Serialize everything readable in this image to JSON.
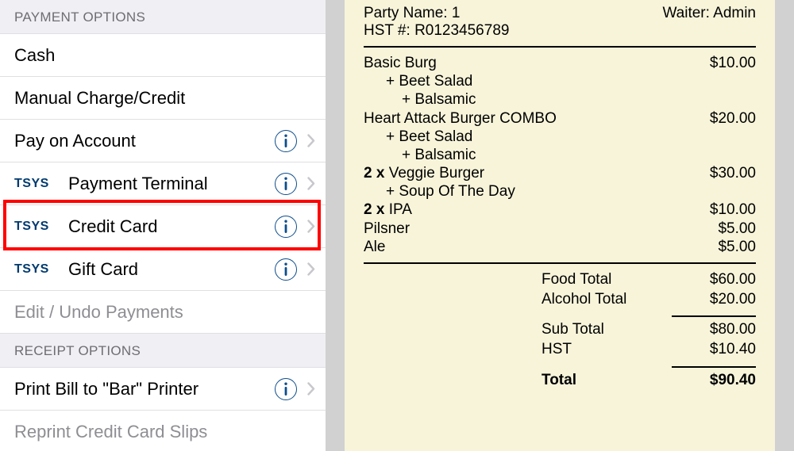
{
  "sidebar": {
    "sections": [
      {
        "title": "PAYMENT OPTIONS",
        "items": [
          {
            "label": "Cash",
            "brand": null,
            "info": false,
            "chevron": false,
            "disabled": false,
            "name": "pay-cash"
          },
          {
            "label": "Manual Charge/Credit",
            "brand": null,
            "info": false,
            "chevron": false,
            "disabled": false,
            "name": "pay-manual"
          },
          {
            "label": "Pay on Account",
            "brand": null,
            "info": true,
            "chevron": true,
            "disabled": false,
            "name": "pay-on-account"
          },
          {
            "label": "Payment Terminal",
            "brand": "TSYS",
            "info": true,
            "chevron": true,
            "disabled": false,
            "name": "pay-terminal"
          },
          {
            "label": "Credit Card",
            "brand": "TSYS",
            "info": true,
            "chevron": true,
            "disabled": false,
            "name": "pay-credit-card",
            "highlighted": true
          },
          {
            "label": "Gift Card",
            "brand": "TSYS",
            "info": true,
            "chevron": true,
            "disabled": false,
            "name": "pay-gift-card"
          },
          {
            "label": "Edit / Undo Payments",
            "brand": null,
            "info": false,
            "chevron": false,
            "disabled": true,
            "name": "edit-undo-payments"
          }
        ]
      },
      {
        "title": "RECEIPT OPTIONS",
        "items": [
          {
            "label": "Print Bill to \"Bar\" Printer",
            "brand": null,
            "info": true,
            "chevron": true,
            "disabled": false,
            "name": "print-bill-bar"
          },
          {
            "label": "Reprint Credit Card Slips",
            "brand": null,
            "info": false,
            "chevron": false,
            "disabled": true,
            "name": "reprint-cc-slips"
          }
        ]
      }
    ]
  },
  "receipt": {
    "party_name_label": "Party Name:",
    "party_name": "1",
    "waiter_label": "Waiter:",
    "waiter": "Admin",
    "hst_label": "HST #:",
    "hst": "R0123456789",
    "items": [
      {
        "name": "Basic Burg",
        "price": "$10.00",
        "qty": null,
        "mods": [
          "+ Beet Salad"
        ],
        "mods2": [
          "+ Balsamic"
        ]
      },
      {
        "name": "Heart Attack Burger COMBO",
        "price": "$20.00",
        "qty": null,
        "mods": [
          "+ Beet Salad"
        ],
        "mods2": [
          "+ Balsamic"
        ]
      },
      {
        "name": "Veggie Burger",
        "price": "$30.00",
        "qty": "2 x ",
        "mods": [
          "+ Soup Of The Day"
        ],
        "mods2": []
      },
      {
        "name": "IPA",
        "price": "$10.00",
        "qty": "2 x ",
        "mods": [],
        "mods2": []
      },
      {
        "name": "Pilsner",
        "price": "$5.00",
        "qty": null,
        "mods": [],
        "mods2": []
      },
      {
        "name": "Ale",
        "price": "$5.00",
        "qty": null,
        "mods": [],
        "mods2": []
      }
    ],
    "subtotals": [
      {
        "label": "Food Total",
        "value": "$60.00"
      },
      {
        "label": "Alcohol Total",
        "value": "$20.00"
      }
    ],
    "taxes": [
      {
        "label": "Sub Total",
        "value": "$80.00"
      },
      {
        "label": "HST",
        "value": "$10.40"
      }
    ],
    "grand_total": {
      "label": "Total",
      "value": "$90.40"
    }
  }
}
